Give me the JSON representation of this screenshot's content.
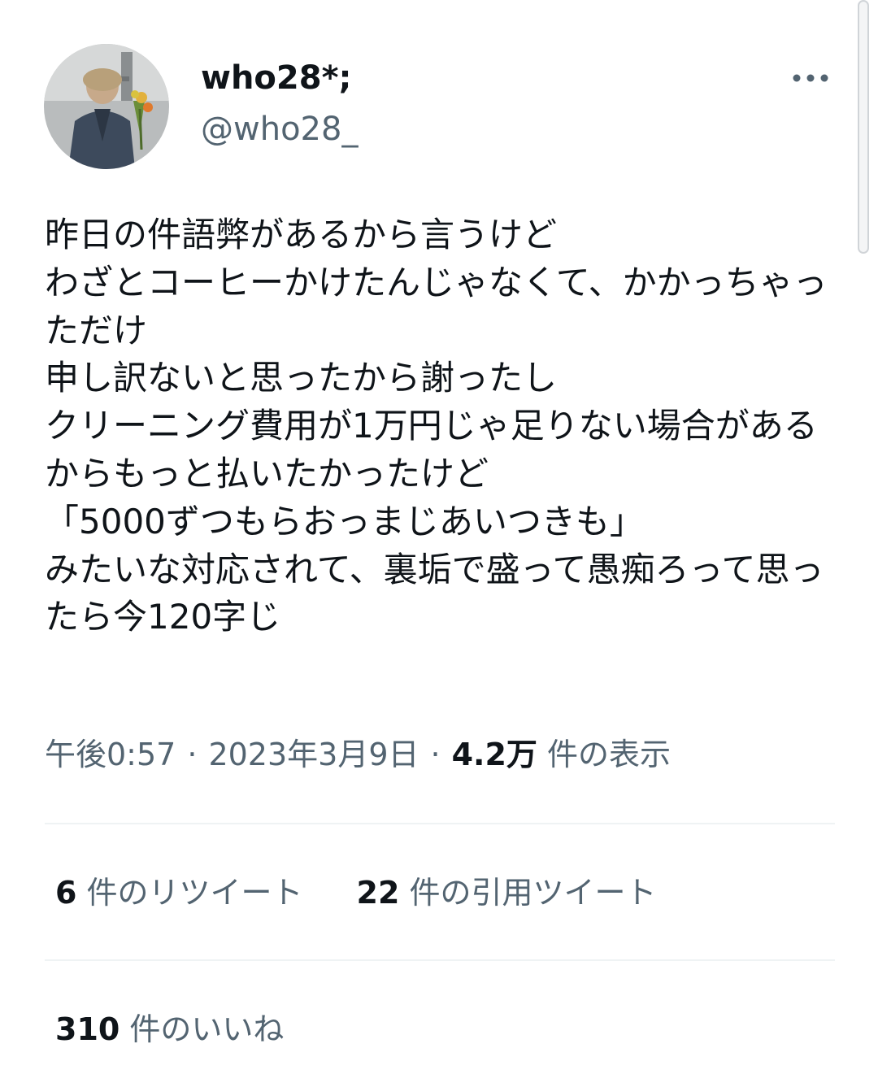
{
  "author": {
    "display_name": "who28*;",
    "handle": "@who28_",
    "avatar_icon": "profile-photo"
  },
  "more_icon": "more-horizontal-icon",
  "tweet": {
    "text": "昨日の件語弊があるから言うけど\nわざとコーヒーかけたんじゃなくて、かかっちゃっただけ\n申し訳ないと思ったから謝ったし\nクリーニング費用が1万円じゃ足りない場合があるからもっと払いたかったけど\n「5000ずつもらおっまじあいつきも」\nみたいな対応されて、裏垢で盛って愚痴ろって思ったら今120字じ"
  },
  "meta": {
    "time": "午後0:57",
    "separator": "·",
    "date": "2023年3月9日",
    "views_count": "4.2万",
    "views_label": " 件の表示"
  },
  "stats": {
    "retweets_count": "6",
    "retweets_label": " 件のリツイート",
    "quotes_count": "22",
    "quotes_label": " 件の引用ツイート",
    "likes_count": "310",
    "likes_label": " 件のいいね"
  },
  "colors": {
    "text_primary": "#0f1419",
    "text_secondary": "#536471",
    "divider": "#eff3f4",
    "background": "#ffffff"
  }
}
